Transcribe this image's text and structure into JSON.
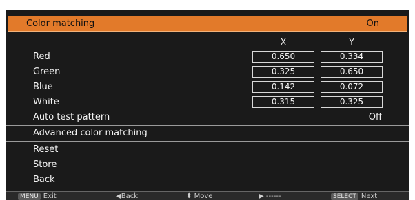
{
  "header": {
    "title": "Color matching",
    "value": "On"
  },
  "columns": {
    "x": "X",
    "y": "Y"
  },
  "rows": [
    {
      "label": "Red",
      "x": "0.650",
      "y": "0.334"
    },
    {
      "label": "Green",
      "x": "0.325",
      "y": "0.650"
    },
    {
      "label": "Blue",
      "x": "0.142",
      "y": "0.072"
    },
    {
      "label": "White",
      "x": "0.315",
      "y": "0.325"
    }
  ],
  "auto_test": {
    "label": "Auto test pattern",
    "value": "Off"
  },
  "menu": {
    "advanced": "Advanced color matching",
    "reset": "Reset",
    "store": "Store",
    "back": "Back"
  },
  "footer": {
    "exit_btn": "MENU",
    "exit": "Exit",
    "back_icon": "◀",
    "back": "Back",
    "move_icon": "⬍",
    "move": "Move",
    "next_icon": "▶",
    "next_text": "------",
    "select_btn": "SELECT",
    "select": "Next"
  },
  "colors": {
    "highlight": "#e27a2a",
    "background": "#1a1a1a"
  }
}
